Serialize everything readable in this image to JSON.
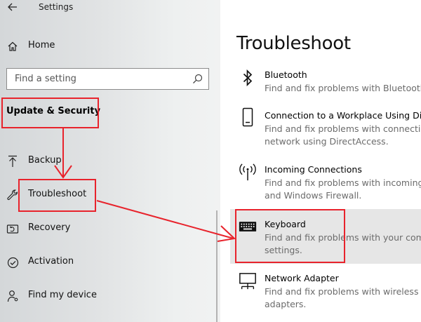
{
  "window": {
    "title": "Settings"
  },
  "sidebar": {
    "home_label": "Home",
    "search_placeholder": "Find a setting",
    "section_heading": "Update & Security",
    "items": [
      {
        "label": "Backup",
        "icon": "upload-arrow-icon"
      },
      {
        "label": "Troubleshoot",
        "icon": "wrench-icon"
      },
      {
        "label": "Recovery",
        "icon": "recovery-icon"
      },
      {
        "label": "Activation",
        "icon": "check-circle-icon"
      },
      {
        "label": "Find my device",
        "icon": "person-location-icon"
      }
    ]
  },
  "main": {
    "title": "Troubleshoot",
    "items": [
      {
        "title": "Bluetooth",
        "description": "Find and fix problems with Bluetooth",
        "icon": "bluetooth-icon"
      },
      {
        "title": "Connection to a Workplace Using Di",
        "description": "Find and fix problems with connectin\nnetwork using DirectAccess.",
        "icon": "phone-device-icon"
      },
      {
        "title": "Incoming Connections",
        "description": "Find and fix problems with incoming\nand Windows Firewall.",
        "icon": "antenna-icon"
      },
      {
        "title": "Keyboard",
        "description": "Find and fix problems with your com\nsettings.",
        "icon": "keyboard-icon"
      },
      {
        "title": "Network Adapter",
        "description": "Find and fix problems with wireless a\nadapters.",
        "icon": "network-adapter-icon"
      }
    ]
  },
  "annotation_color": "#e8232c"
}
